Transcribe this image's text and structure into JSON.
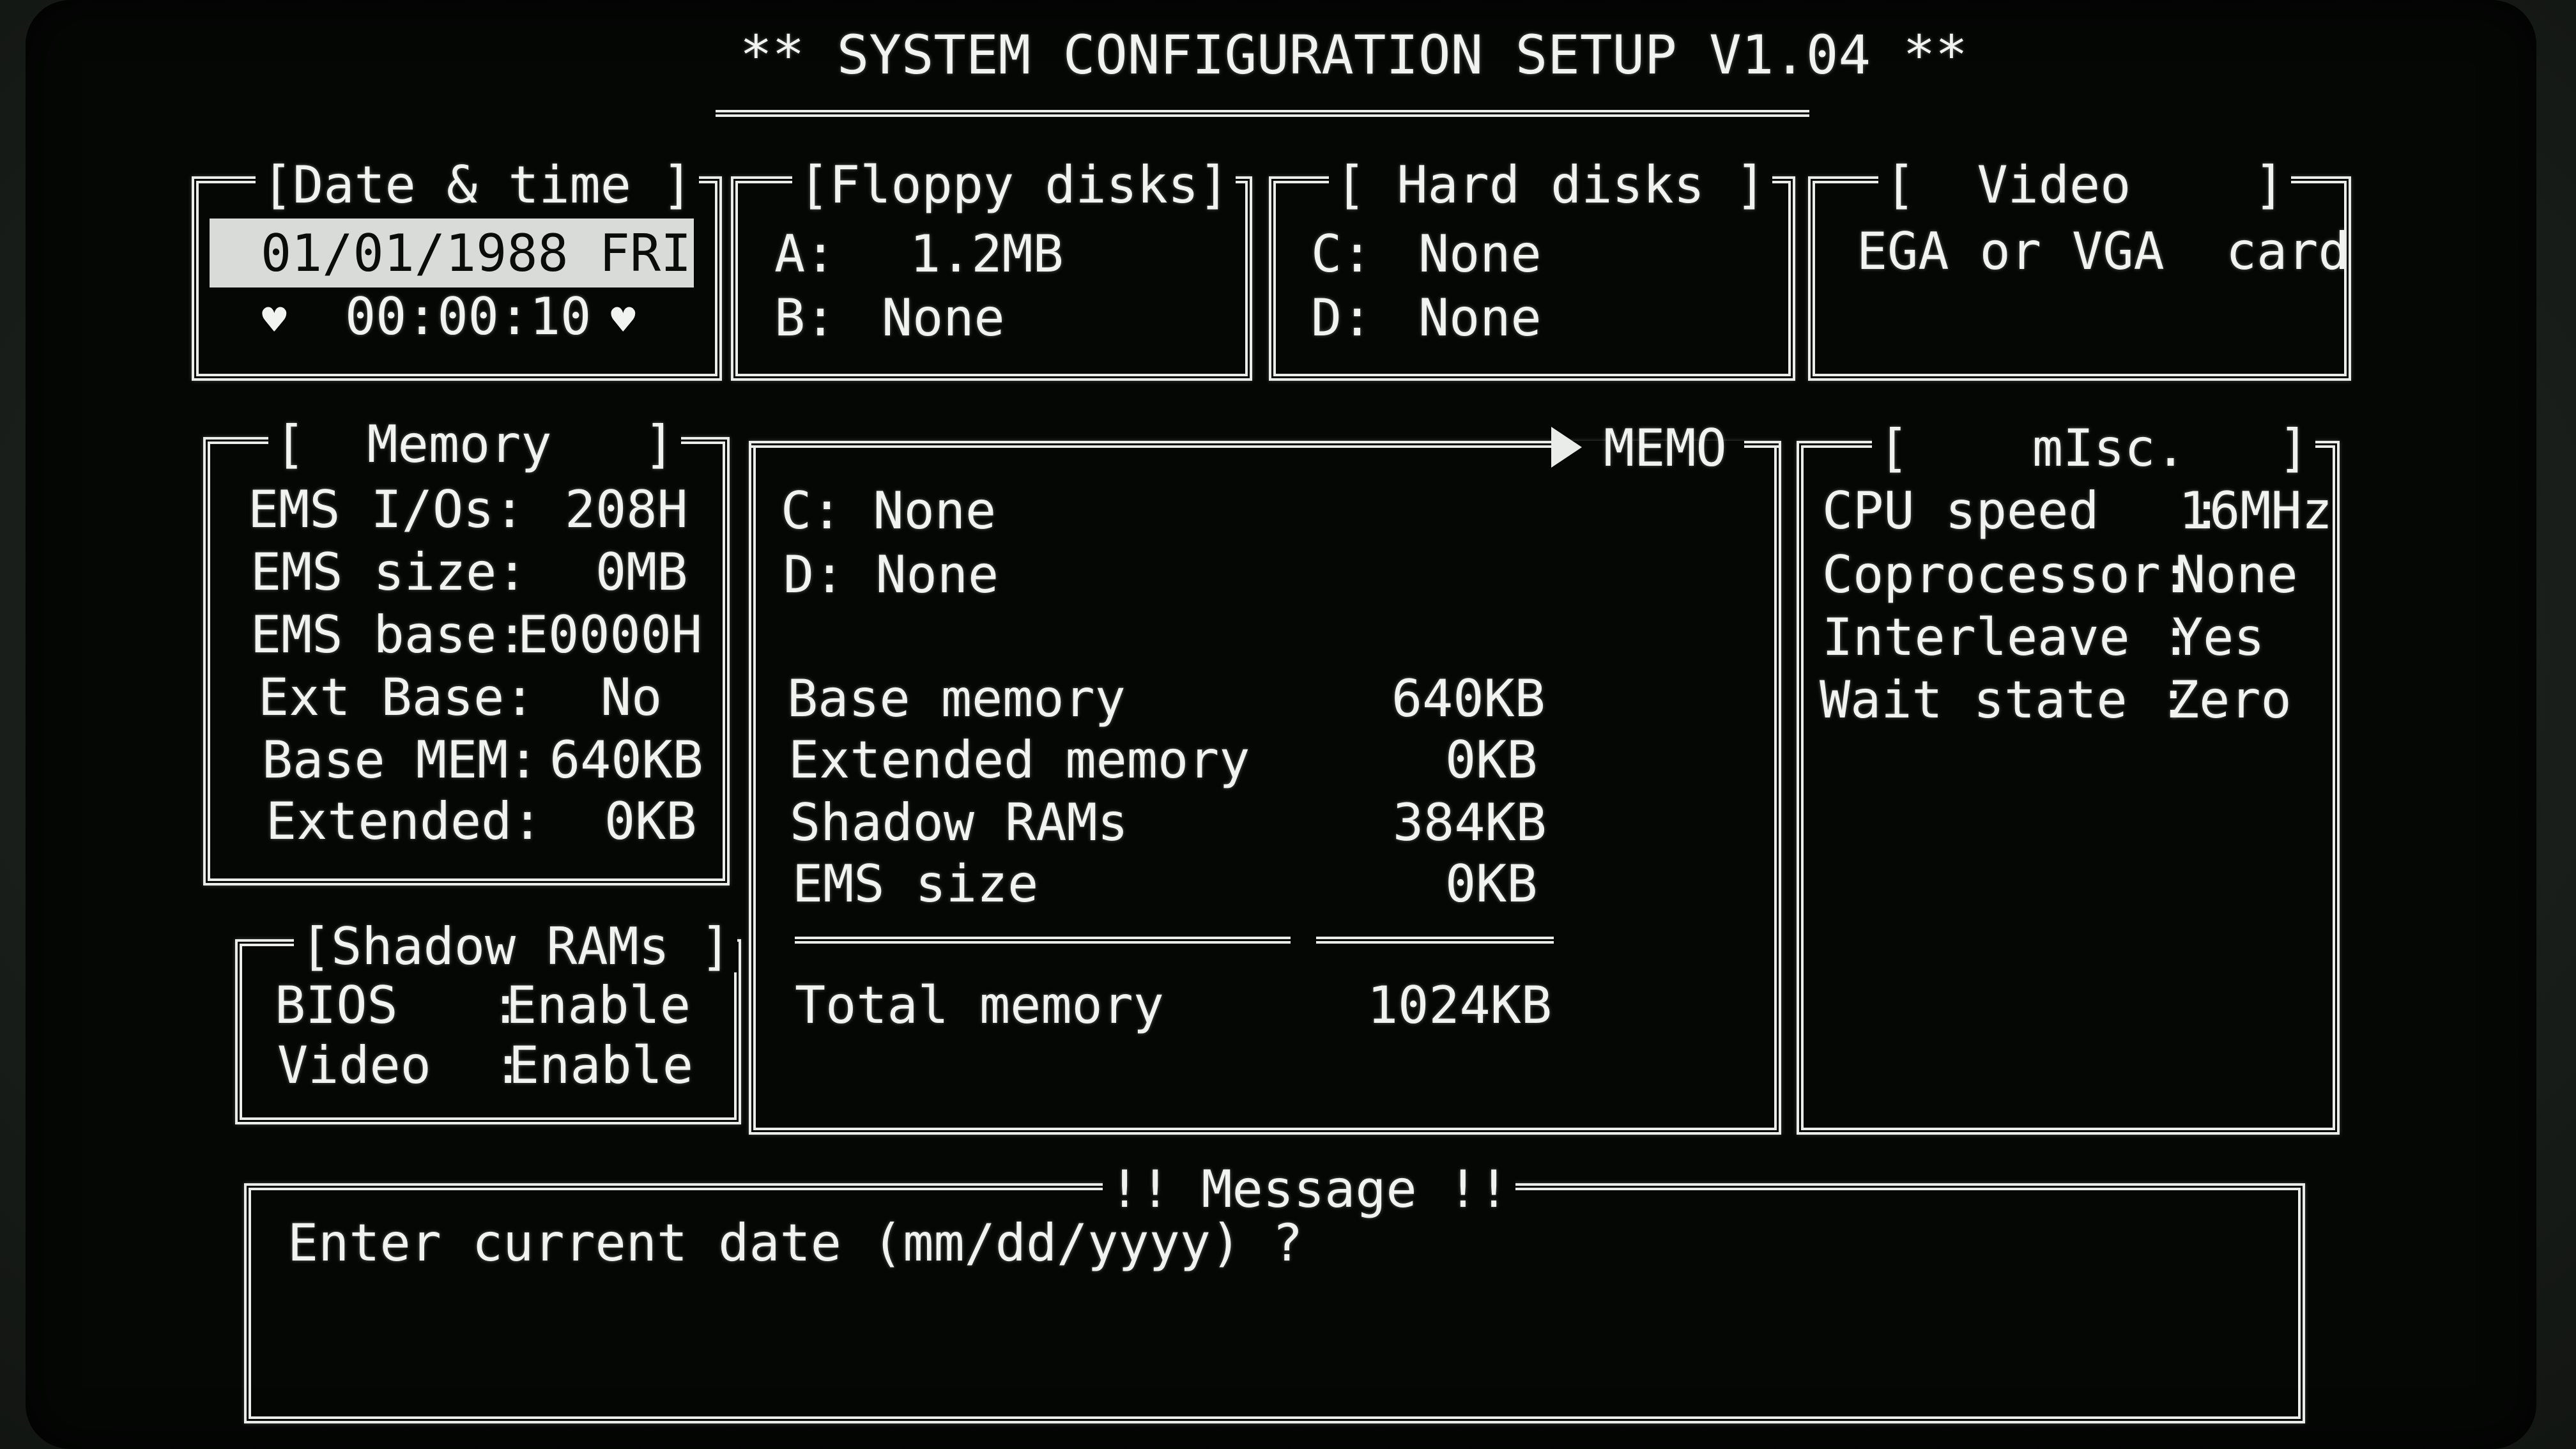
{
  "title": "** SYSTEM CONFIGURATION SETUP V1.04 **",
  "date_time": {
    "legend": "[Date & time ]",
    "date": "01/01/1988 FRI",
    "time": "00:00:10",
    "marker_glyph": "♥"
  },
  "floppy": {
    "legend": "[Floppy disks]",
    "rows": [
      {
        "label": "A:",
        "value": "1.2MB"
      },
      {
        "label": "B:",
        "value": "None"
      }
    ]
  },
  "hard": {
    "legend": "[ Hard disks ]",
    "rows": [
      {
        "label": "C:",
        "value": "None"
      },
      {
        "label": "D:",
        "value": "None"
      }
    ]
  },
  "video": {
    "legend": "[  Video    ]",
    "value": "EGA or VGA  card"
  },
  "memory": {
    "legend": "[  Memory   ]",
    "rows": [
      {
        "label": "EMS I/Os:",
        "value": "208H"
      },
      {
        "label": "EMS size:",
        "value": "0MB"
      },
      {
        "label": "EMS base:",
        "value": "E0000H"
      },
      {
        "label": "Ext Base:",
        "value": "No"
      },
      {
        "label": "Base MEM:",
        "value": "640KB"
      },
      {
        "label": "Extended:",
        "value": "0KB"
      }
    ]
  },
  "shadow": {
    "legend": "[Shadow RAMs ]",
    "rows": [
      {
        "label": "BIOS   :",
        "value": "Enable"
      },
      {
        "label": "Video  :",
        "value": "Enable"
      }
    ]
  },
  "summary": {
    "legend": "MEMO",
    "drives": [
      "C: None",
      "D: None"
    ],
    "rows": [
      {
        "label": "Base memory",
        "value": "640KB"
      },
      {
        "label": "Extended memory",
        "value": "0KB"
      },
      {
        "label": "Shadow RAMs",
        "value": "384KB"
      },
      {
        "label": "EMS size",
        "value": "0KB"
      }
    ],
    "total_label": "Total memory",
    "total_value": "1024KB"
  },
  "misc": {
    "legend": "[    mIsc.   ]",
    "rows": [
      {
        "label": "CPU speed   :",
        "value": "16MHz"
      },
      {
        "label": "Coprocessor:",
        "value": "None"
      },
      {
        "label": "Interleave :",
        "value": "Yes"
      },
      {
        "label": "Wait state :",
        "value": "Zero"
      }
    ]
  },
  "message": {
    "legend": "!! Message !!",
    "text": "Enter current date (mm/dd/yyyy) ?"
  },
  "colors": {
    "screen_bg": "#050705",
    "text": "#f1f3f1",
    "highlight_bg": "#d9dbd9",
    "highlight_text": "#0a0c0a"
  }
}
